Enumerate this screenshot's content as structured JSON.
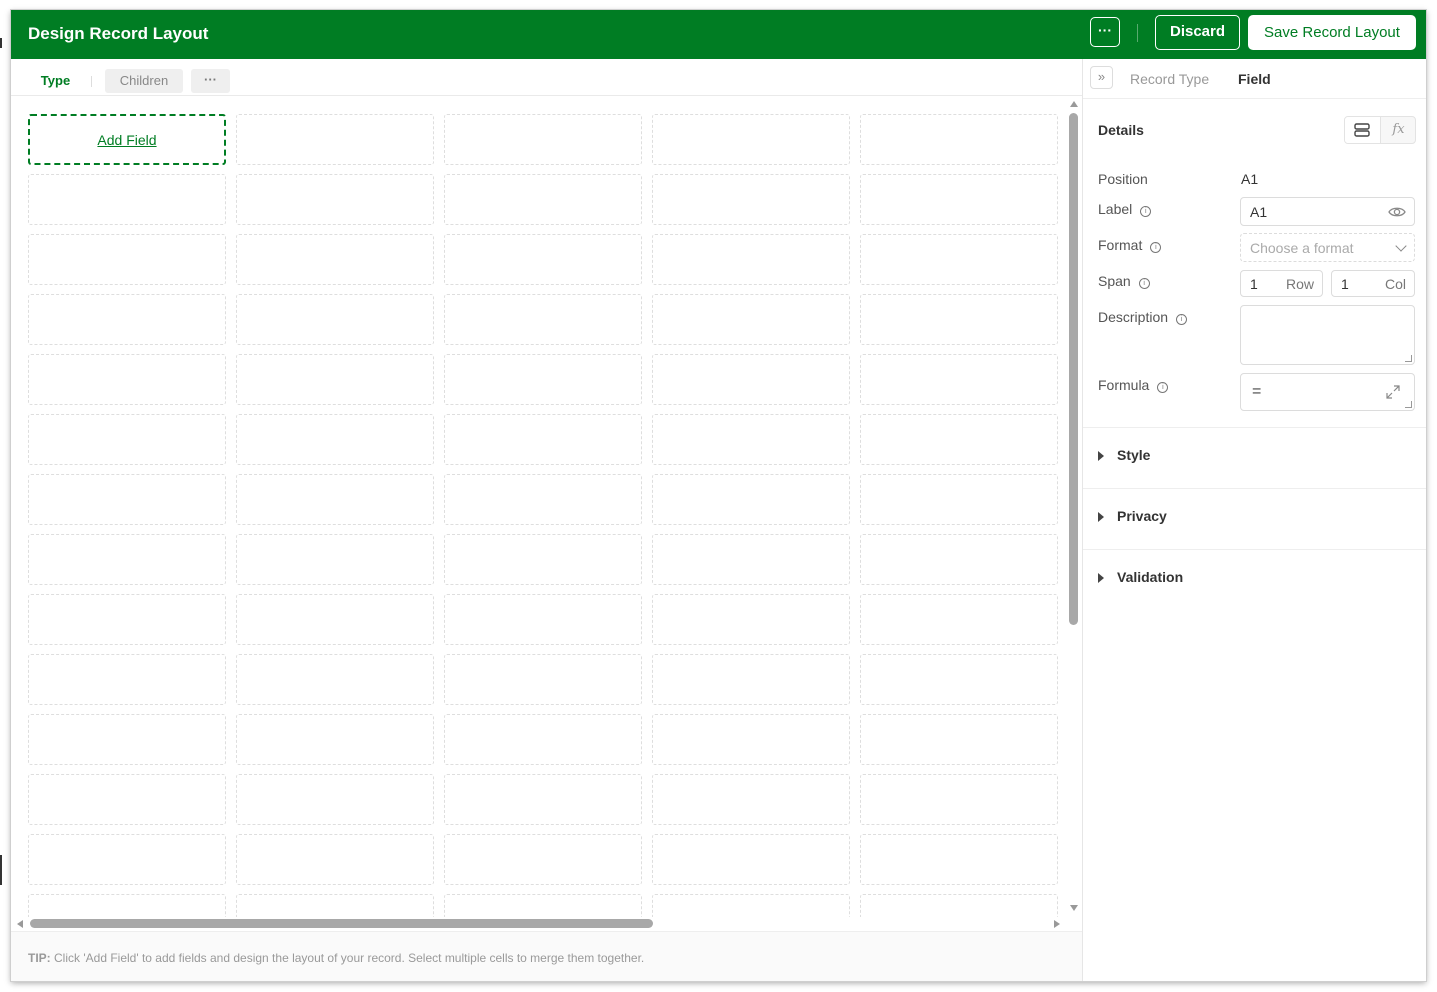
{
  "header": {
    "title": "Design Record Layout",
    "more_label": "···",
    "discard_label": "Discard",
    "save_label": "Save Record Layout",
    "brand_color": "#007d23"
  },
  "tabs": [
    {
      "label": "Type",
      "active": true
    },
    {
      "label": "Children",
      "active": false
    },
    {
      "label": "···",
      "active": false
    }
  ],
  "grid": {
    "add_field_label": "Add Field",
    "columns": 5,
    "visible_rows": 14
  },
  "tip": {
    "prefix": "TIP:",
    "text": "Click 'Add Field' to add fields and design the layout of your record. Select multiple cells to merge them together."
  },
  "panel": {
    "collapse_icon": "»",
    "breadcrumb": {
      "record_type": "Record Type",
      "field": "Field"
    },
    "details_title": "Details",
    "view_toggle": {
      "icons": [
        "rows-icon",
        "function-icon"
      ],
      "function_glyph": "fx"
    },
    "fields": {
      "position_label": "Position",
      "position_value": "A1",
      "label_label": "Label",
      "label_value": "A1",
      "format_label": "Format",
      "format_placeholder": "Choose a format",
      "span_label": "Span",
      "span_row_value": "1",
      "span_row_unit": "Row",
      "span_col_value": "1",
      "span_col_unit": "Col",
      "description_label": "Description",
      "description_value": "",
      "formula_label": "Formula",
      "formula_value": "="
    },
    "sections": [
      "Style",
      "Privacy",
      "Validation"
    ]
  }
}
